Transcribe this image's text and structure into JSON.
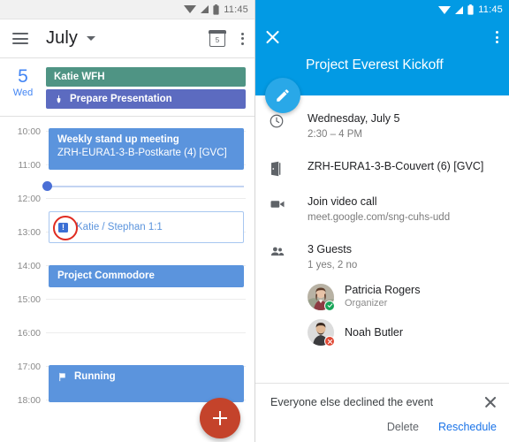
{
  "left": {
    "statusbar": {
      "time": "11:45",
      "icons": [
        "wifi-icon",
        "signal-icon",
        "battery-icon"
      ]
    },
    "appbar": {
      "menu_icon": "hamburger-menu-icon",
      "month": "July",
      "dropdown_icon": "chevron-down-icon",
      "calendar_icon_day": "5",
      "overflow_icon": "more-vert-icon"
    },
    "daystrip": {
      "day_number": "5",
      "day_name": "Wed",
      "chips": [
        {
          "label": "Katie WFH",
          "color": "#4f9484",
          "icon": ""
        },
        {
          "label": "Prepare Presentation",
          "color": "#5c6bc0",
          "icon": "task-icon"
        }
      ]
    },
    "hours": [
      "10:00",
      "11:00",
      "12:00",
      "13:00",
      "14:00",
      "15:00",
      "16:00",
      "17:00",
      "18:00"
    ],
    "events": [
      {
        "title": "Weekly stand up meeting",
        "sub": "ZRH-EURA1-3-B-Postkarte (4) [GVC]",
        "style": "filled"
      },
      {
        "title": "Katie / Stephan 1:1",
        "sub": "",
        "style": "outline",
        "badge": "!"
      },
      {
        "title": "Project Commodore",
        "sub": "",
        "style": "filled"
      },
      {
        "title": "Running",
        "sub": "",
        "style": "filled",
        "icon": "flag-icon"
      }
    ],
    "now_indicator": {
      "label": "current-time-indicator"
    },
    "fab": {
      "icon": "plus-icon",
      "color": "#c4432b"
    },
    "annotation": {
      "shape": "red-circle-highlight",
      "color": "#e02b20"
    }
  },
  "right": {
    "statusbar": {
      "time": "11:45"
    },
    "header": {
      "close_icon": "close-icon",
      "overflow_icon": "more-vert-icon",
      "title": "Project Everest Kickoff",
      "color": "#029ae4"
    },
    "edit_fab": {
      "icon": "pencil-icon",
      "color": "#29a8e8"
    },
    "details": [
      {
        "icon": "clock-icon",
        "primary": "Wednesday, July 5",
        "secondary": "2:30 – 4 PM"
      },
      {
        "icon": "room-door-icon",
        "primary": "ZRH-EURA1-3-B-Couvert (6) [GVC]",
        "secondary": ""
      },
      {
        "icon": "video-camera-icon",
        "primary": "Join video call",
        "secondary": "meet.google.com/sng-cuhs-udd"
      },
      {
        "icon": "people-icon",
        "primary": "3 Guests",
        "secondary": "1 yes, 2 no"
      }
    ],
    "guests": [
      {
        "name": "Patricia Rogers",
        "role": "Organizer",
        "status": "yes",
        "avatar": "avatar-patricia"
      },
      {
        "name": "Noah Butler",
        "role": "",
        "status": "no",
        "avatar": "avatar-noah"
      }
    ],
    "snackbar": {
      "message": "Everyone else declined the event",
      "close_icon": "close-icon",
      "delete_label": "Delete",
      "reschedule_label": "Reschedule"
    }
  }
}
